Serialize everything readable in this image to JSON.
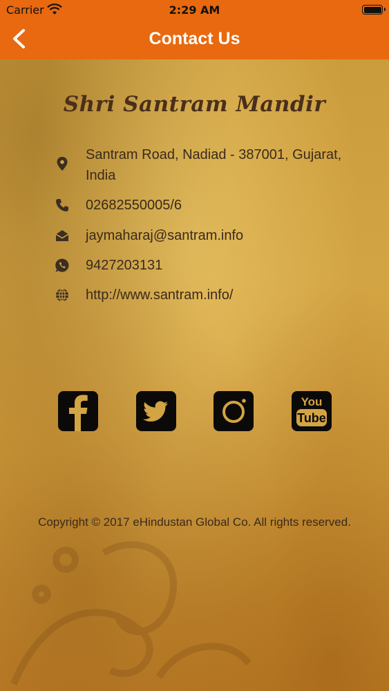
{
  "status_bar": {
    "carrier": "Carrier",
    "time": "2:29 AM"
  },
  "nav": {
    "title": "Contact Us"
  },
  "heading": "Shri Santram Mandir",
  "contacts": {
    "address": "Santram Road, Nadiad - 387001, Gujarat, India",
    "phone": "02682550005/6",
    "email": "jaymaharaj@santram.info",
    "whatsapp": "9427203131",
    "website": "http://www.santram.info/"
  },
  "social": [
    "facebook",
    "twitter",
    "instagram",
    "youtube"
  ],
  "footer": {
    "copyright": "Copyright © 2017 eHindustan Global Co. All rights reserved."
  },
  "colors": {
    "nav_bar": "#e8690f",
    "text": "#3a2a1a",
    "heading": "#4a2f1a"
  }
}
